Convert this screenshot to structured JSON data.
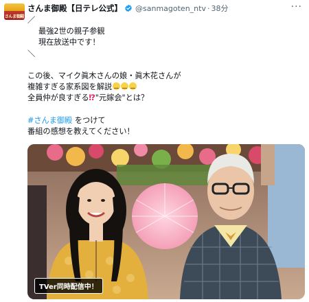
{
  "account": {
    "avatar_text": "さんま御殿",
    "display_name": "さんま御殿【日テレ公式】",
    "handle": "@sanmagoten_ntv",
    "separator": "·",
    "time": "38分",
    "more_label": "···"
  },
  "tweet": {
    "deco_top": "／",
    "line1": "最強2世の親子参観",
    "line2": "現在放送中です！",
    "deco_bottom": "＼",
    "line3": "この後、マイク眞木さんの娘・眞木花さんが",
    "line4": "複雑すぎる家系図を解説",
    "line5_pre": "全員仲が良すぎる",
    "line5_bang": "⁉",
    "line5_post": "\"元嫁会\"とは？",
    "hashtag": "#さんま御殿",
    "line6_post": " をつけて",
    "line7": "番組の感想を教えてください！"
  },
  "media": {
    "badge": "TVer同時配信中！"
  },
  "colors": {
    "link": "#1d9bf0",
    "text": "#0f1419",
    "secondary": "#536471",
    "verified": "#1d9bf0"
  },
  "icons": [
    "verified-badge-icon",
    "more-icon"
  ]
}
